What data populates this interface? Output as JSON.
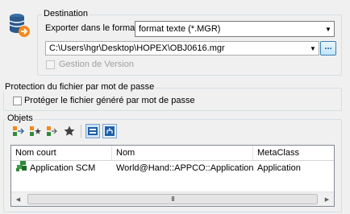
{
  "destination": {
    "title": "Destination",
    "export_label": "Exporter dans le format",
    "format_value": "format texte (*.MGR)",
    "path_value": "C:\\Users\\hgr\\Desktop\\HOPEX\\OBJ0616.mgr",
    "browse_label": "...",
    "version_label": "Gestion de Version"
  },
  "password": {
    "title": "Protection du fichier par mot de passe",
    "checkbox_label": "Protéger le fichier généré par mot de passe"
  },
  "objects": {
    "title": "Objets",
    "toolbar": [
      "add-object-icon",
      "add-favorite-object-icon",
      "add-linked-object-icon",
      "favorite-star-icon",
      "list-view-icon",
      "tree-view-icon"
    ],
    "columns": [
      "Nom court",
      "Nom",
      "MetaClass"
    ],
    "rows": [
      {
        "short_name": "Application SCM",
        "name": "World@Hand::APPCO::Application S...",
        "metaclass": "Application"
      }
    ],
    "scroll_grip": "III"
  },
  "colors": {
    "accent": "#3c7fb1",
    "orange": "#f28a1c",
    "db_blue": "#2d5a8c",
    "app_green": "#2e8b3a"
  }
}
